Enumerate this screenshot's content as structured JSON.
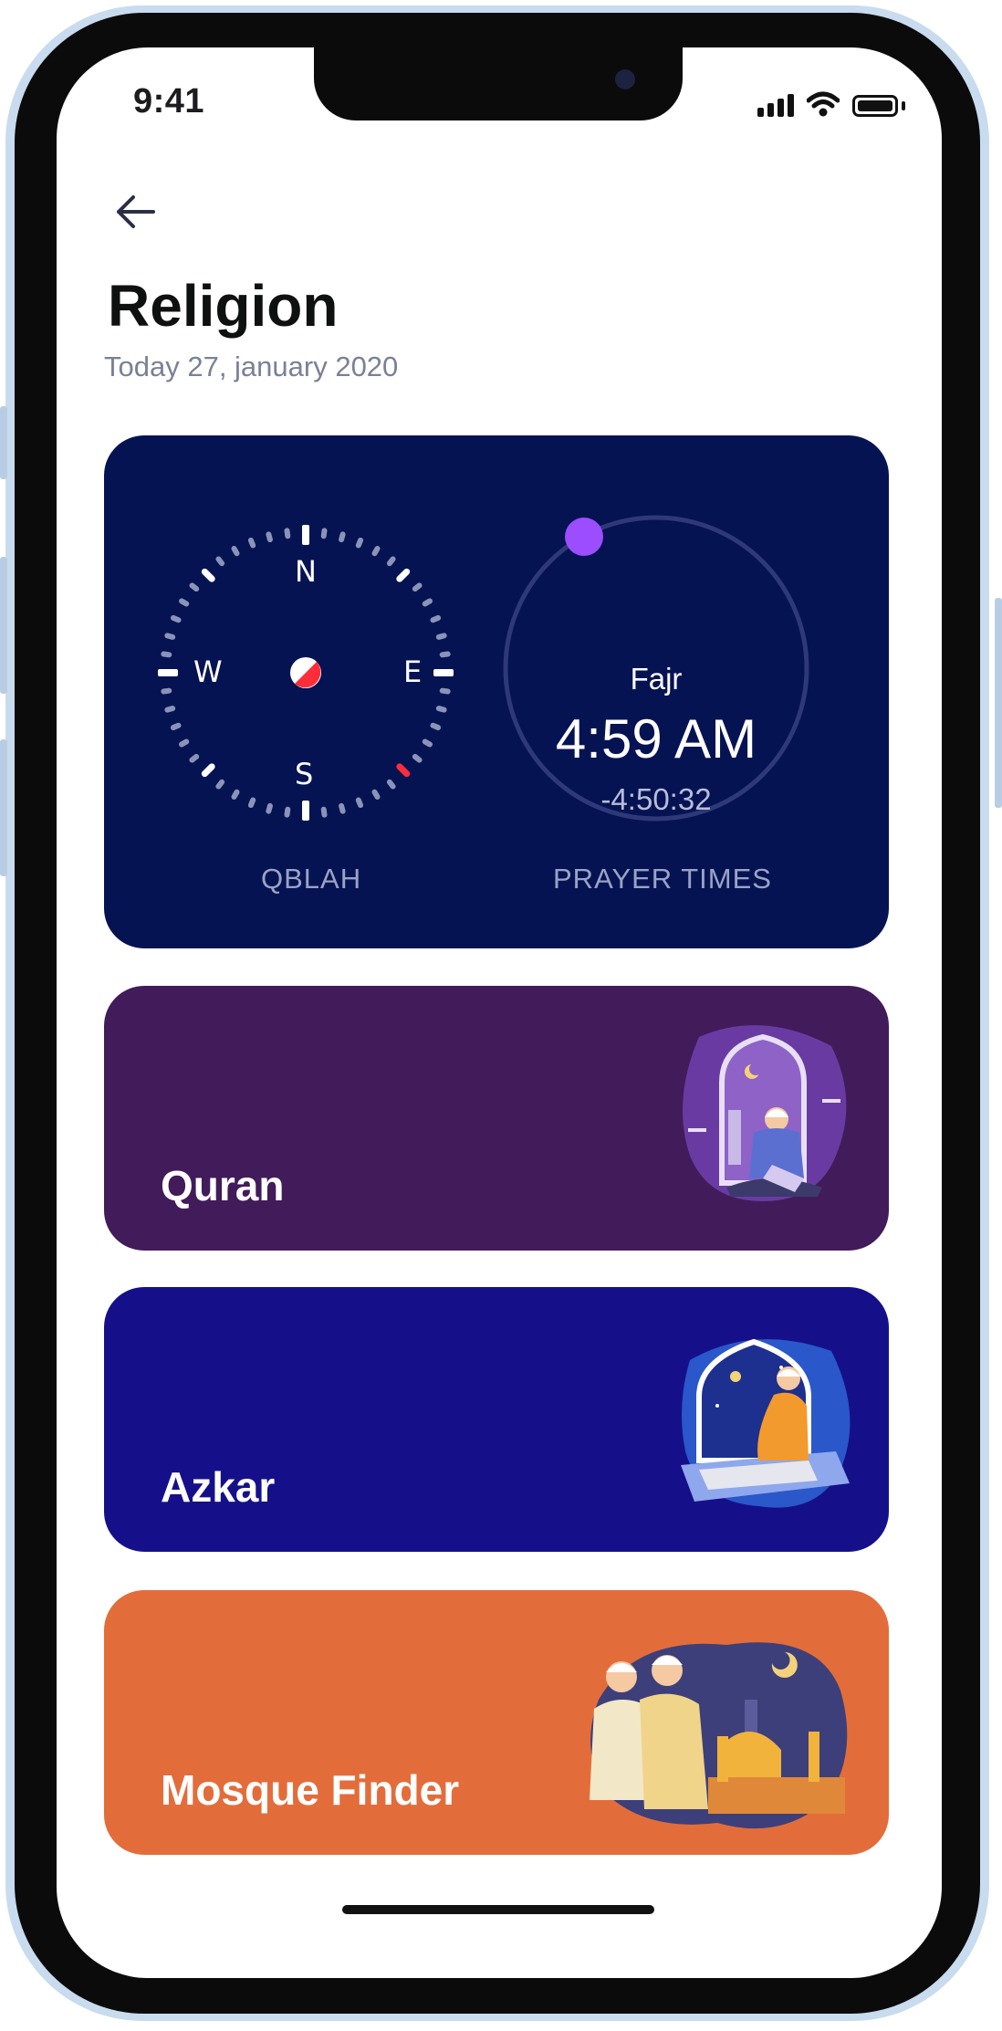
{
  "status_bar": {
    "time": "9:41"
  },
  "header": {
    "title": "Religion",
    "date": "Today 27, january 2020"
  },
  "dashboard": {
    "compass": {
      "north": "N",
      "south": "S",
      "east": "E",
      "west": "W",
      "label": "QBLAH"
    },
    "prayer": {
      "name": "Fajr",
      "time": "4:59 AM",
      "countdown": "-4:50:32",
      "label": "PRAYER TIMES"
    }
  },
  "cards": {
    "quran": {
      "label": "Quran"
    },
    "azkar": {
      "label": "Azkar"
    },
    "mosque": {
      "label": "Mosque Finder"
    }
  },
  "colors": {
    "dashboard_bg": "#061353",
    "quran_bg": "#421b5a",
    "azkar_bg": "#15108a",
    "mosque_bg": "#e36d3a",
    "accent": "#9b4dff"
  }
}
